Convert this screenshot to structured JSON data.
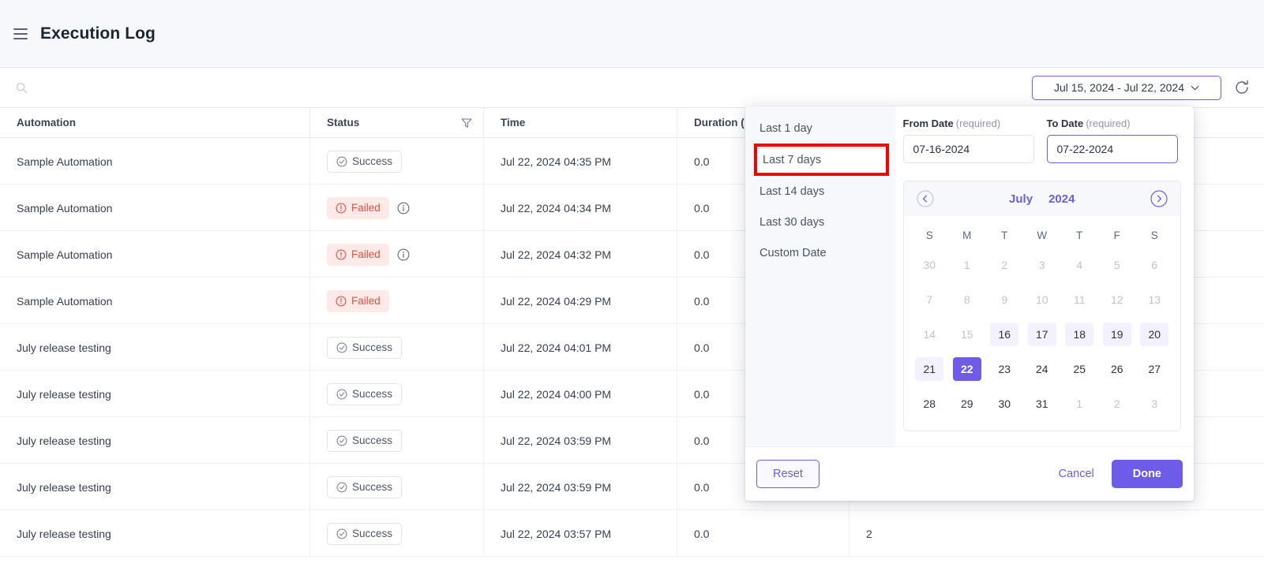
{
  "header": {
    "title": "Execution Log",
    "menu_icon": "hamburger-icon"
  },
  "toolbar": {
    "search_placeholder": "",
    "search_value": "",
    "search_icon": "search-icon",
    "date_range_label": "Jul 15, 2024 - Jul 22, 2024",
    "chevron_icon": "chevron-down-icon",
    "refresh_icon": "refresh-icon"
  },
  "table": {
    "columns": [
      {
        "key": "automation",
        "label": "Automation"
      },
      {
        "key": "status",
        "label": "Status"
      },
      {
        "key": "time",
        "label": "Time"
      },
      {
        "key": "duration",
        "label": "Duration ("
      },
      {
        "key": "extra",
        "label": ""
      }
    ],
    "filter_icon": "filter-icon",
    "rows": [
      {
        "automation": "Sample Automation",
        "status": "Success",
        "status_type": "success",
        "info": false,
        "time": "Jul 22, 2024 04:35 PM",
        "duration": "0.0",
        "extra": ""
      },
      {
        "automation": "Sample Automation",
        "status": "Failed",
        "status_type": "failed",
        "info": true,
        "time": "Jul 22, 2024 04:34 PM",
        "duration": "0.0",
        "extra": ""
      },
      {
        "automation": "Sample Automation",
        "status": "Failed",
        "status_type": "failed",
        "info": true,
        "time": "Jul 22, 2024 04:32 PM",
        "duration": "0.0",
        "extra": ""
      },
      {
        "automation": "Sample Automation",
        "status": "Failed",
        "status_type": "failed",
        "info": false,
        "time": "Jul 22, 2024 04:29 PM",
        "duration": "0.0",
        "extra": ""
      },
      {
        "automation": "July release testing",
        "status": "Success",
        "status_type": "success",
        "info": false,
        "time": "Jul 22, 2024 04:01 PM",
        "duration": "0.0",
        "extra": ""
      },
      {
        "automation": "July release testing",
        "status": "Success",
        "status_type": "success",
        "info": false,
        "time": "Jul 22, 2024 04:00 PM",
        "duration": "0.0",
        "extra": ""
      },
      {
        "automation": "July release testing",
        "status": "Success",
        "status_type": "success",
        "info": false,
        "time": "Jul 22, 2024 03:59 PM",
        "duration": "0.0",
        "extra": ""
      },
      {
        "automation": "July release testing",
        "status": "Success",
        "status_type": "success",
        "info": false,
        "time": "Jul 22, 2024 03:59 PM",
        "duration": "0.0",
        "extra": ""
      },
      {
        "automation": "July release testing",
        "status": "Success",
        "status_type": "success",
        "info": false,
        "time": "Jul 22, 2024 03:57 PM",
        "duration": "0.0",
        "extra": "2"
      }
    ]
  },
  "date_picker": {
    "presets": [
      {
        "label": "Last 1 day",
        "highlighted": false
      },
      {
        "label": "Last 7 days",
        "highlighted": true
      },
      {
        "label": "Last 14 days",
        "highlighted": false
      },
      {
        "label": "Last 30 days",
        "highlighted": false
      },
      {
        "label": "Custom Date",
        "highlighted": false
      }
    ],
    "from": {
      "label": "From Date",
      "required_text": "(required)",
      "value": "07-16-2024",
      "focused": false
    },
    "to": {
      "label": "To Date",
      "required_text": "(required)",
      "value": "07-22-2024",
      "focused": true
    },
    "calendar": {
      "month": "July",
      "year": "2024",
      "prev_icon": "chevron-left-circle-icon",
      "next_icon": "chevron-right-circle-icon",
      "dow": [
        "S",
        "M",
        "T",
        "W",
        "T",
        "F",
        "S"
      ],
      "weeks": [
        [
          {
            "d": "30",
            "state": "mute"
          },
          {
            "d": "1",
            "state": "mute"
          },
          {
            "d": "2",
            "state": "mute"
          },
          {
            "d": "3",
            "state": "mute"
          },
          {
            "d": "4",
            "state": "mute"
          },
          {
            "d": "5",
            "state": "mute"
          },
          {
            "d": "6",
            "state": "mute"
          }
        ],
        [
          {
            "d": "7",
            "state": "mute"
          },
          {
            "d": "8",
            "state": "mute"
          },
          {
            "d": "9",
            "state": "mute"
          },
          {
            "d": "10",
            "state": "mute"
          },
          {
            "d": "11",
            "state": "mute"
          },
          {
            "d": "12",
            "state": "mute"
          },
          {
            "d": "13",
            "state": "mute"
          }
        ],
        [
          {
            "d": "14",
            "state": "mute"
          },
          {
            "d": "15",
            "state": "mute"
          },
          {
            "d": "16",
            "state": "inrange"
          },
          {
            "d": "17",
            "state": "inrange"
          },
          {
            "d": "18",
            "state": "inrange"
          },
          {
            "d": "19",
            "state": "inrange"
          },
          {
            "d": "20",
            "state": "inrange"
          }
        ],
        [
          {
            "d": "21",
            "state": "inrange"
          },
          {
            "d": "22",
            "state": "selected"
          },
          {
            "d": "23",
            "state": "normal"
          },
          {
            "d": "24",
            "state": "normal"
          },
          {
            "d": "25",
            "state": "normal"
          },
          {
            "d": "26",
            "state": "normal"
          },
          {
            "d": "27",
            "state": "normal"
          }
        ],
        [
          {
            "d": "28",
            "state": "normal"
          },
          {
            "d": "29",
            "state": "normal"
          },
          {
            "d": "30",
            "state": "normal"
          },
          {
            "d": "31",
            "state": "normal"
          },
          {
            "d": "1",
            "state": "mute"
          },
          {
            "d": "2",
            "state": "mute"
          },
          {
            "d": "3",
            "state": "mute"
          }
        ]
      ]
    },
    "footer": {
      "reset_label": "Reset",
      "cancel_label": "Cancel",
      "done_label": "Done"
    }
  },
  "colors": {
    "accent": "#6c5ce7",
    "highlight_box": "#f40000",
    "failed": "#e0503c",
    "failed_bg": "#fde9e7",
    "range_bg": "#f3f1fe"
  }
}
